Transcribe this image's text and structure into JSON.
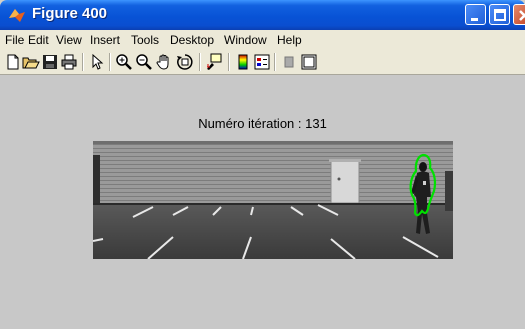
{
  "window": {
    "title": "Figure 400",
    "controls": [
      "minimize-icon",
      "maximize-icon",
      "close-icon"
    ]
  },
  "menu": [
    "File",
    "Edit",
    "View",
    "Insert",
    "Tools",
    "Desktop",
    "Window",
    "Help"
  ],
  "toolbar": {
    "tools": [
      "new-figure-icon",
      "open-file-icon",
      "save-icon",
      "print-icon",
      "edit-plot-arrow-icon",
      "zoom-in-icon",
      "zoom-out-icon",
      "pan-hand-icon",
      "rotate-3d-icon",
      "data-cursor-icon",
      "insert-colorbar-icon",
      "insert-legend-icon",
      "hide-plot-tools-icon",
      "show-plot-tools-icon"
    ]
  },
  "figure": {
    "title": "Numéro itération :  131",
    "image": "parking-lot-pedestrian-photo",
    "contour_color": "#00e000"
  }
}
